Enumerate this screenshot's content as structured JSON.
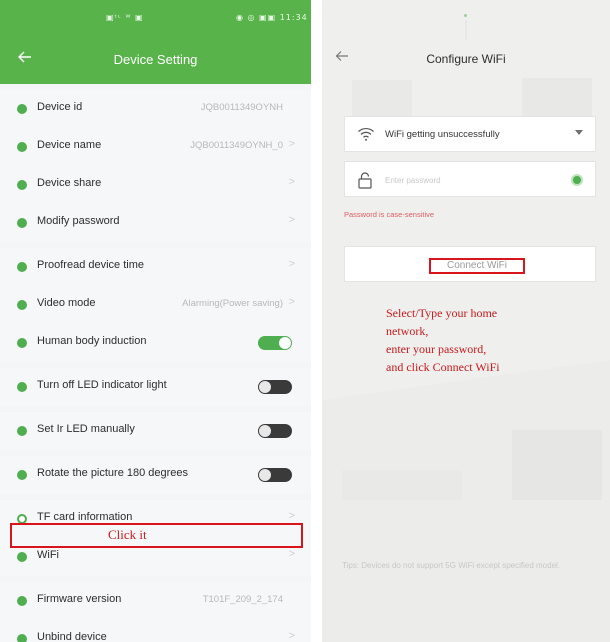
{
  "left": {
    "status_left": "▣ᵗᶫ ᵂ ▣",
    "status_right": "◉ ◎ ▣▣ 11:34",
    "title": "Device Setting",
    "rows": [
      {
        "label": "Device id",
        "value": "JQB0011349OYNH",
        "chevron": "",
        "control": "none"
      },
      {
        "label": "Device name",
        "value": "JQB0011349OYNH_0",
        "chevron": ">",
        "control": "none"
      },
      {
        "label": "Device share",
        "value": "",
        "chevron": ">",
        "control": "none"
      },
      {
        "label": "Modify password",
        "value": "",
        "chevron": ">",
        "control": "none"
      },
      {
        "label": "Proofread device time",
        "value": "",
        "chevron": ">",
        "control": "none"
      },
      {
        "label": "Video mode",
        "value": "Alarming(Power saving)",
        "chevron": ">",
        "control": "none"
      },
      {
        "label": "Human body induction",
        "value": "",
        "chevron": "",
        "control": "toggle-on"
      },
      {
        "label": "Turn off LED indicator light",
        "value": "",
        "chevron": "",
        "control": "toggle-off"
      },
      {
        "label": "Set Ir LED manually",
        "value": "",
        "chevron": "",
        "control": "toggle-off"
      },
      {
        "label": "Rotate the picture 180 degrees",
        "value": "",
        "chevron": "",
        "control": "toggle-off"
      },
      {
        "label": "TF card information",
        "value": "",
        "chevron": ">",
        "control": "none"
      },
      {
        "label": "WiFi",
        "value": "",
        "chevron": ">",
        "control": "none"
      },
      {
        "label": "Firmware version",
        "value": "T101F_209_2_174",
        "chevron": "",
        "control": "none"
      },
      {
        "label": "Unbind device",
        "value": "",
        "chevron": ">",
        "control": "none"
      }
    ],
    "annotation": "Click it"
  },
  "right": {
    "title": "Configure WiFi",
    "wifi_selected": "WiFi getting unsuccessfully",
    "password_placeholder": "Enter password",
    "password_value": "",
    "password_hint": "Password is case-sensitive",
    "connect_label": "Connect WiFi",
    "instructions": [
      "Select/Type your home",
      "network,",
      "enter your password,",
      "and click    Connect WiFi"
    ],
    "tips": "Tips: Devices do not support 5G WiFi except specified model."
  },
  "colors": {
    "header_green": "#58b44a",
    "accent_green": "#4fae4f",
    "annotation_red": "#d9141b"
  },
  "icons": [
    "back-arrow-icon",
    "wifi-icon",
    "lock-icon",
    "eye-icon",
    "chevron-right-icon",
    "dropdown-caret-icon"
  ]
}
